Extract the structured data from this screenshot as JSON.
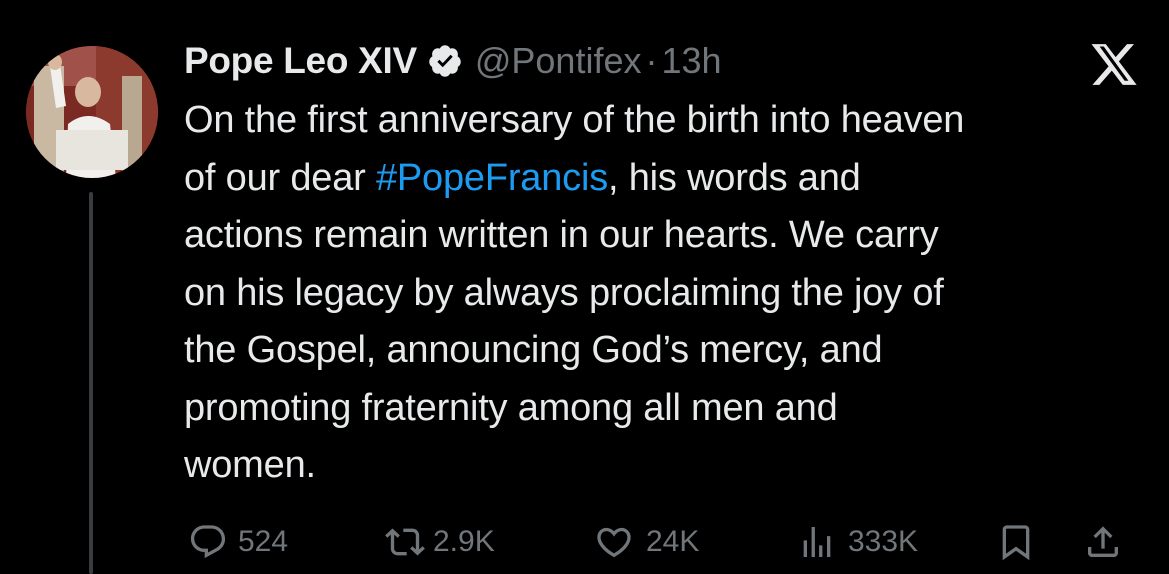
{
  "author": {
    "display_name": "Pope Leo XIV",
    "handle": "@Pontifex",
    "separator": "·",
    "time_ago": "13h",
    "verified": true
  },
  "platform_icon": "x-logo-icon",
  "tweet": {
    "lines": [
      [
        {
          "t": "On the first anniversary of the birth into heaven"
        }
      ],
      [
        {
          "t": "of our dear "
        },
        {
          "t": "#PopeFrancis",
          "tag": true
        },
        {
          "t": ", his words and"
        }
      ],
      [
        {
          "t": "actions remain written in our hearts. We carry"
        }
      ],
      [
        {
          "t": "on his legacy by always proclaiming the joy of"
        }
      ],
      [
        {
          "t": "the Gospel, announcing God’s mercy, and"
        }
      ],
      [
        {
          "t": "promoting fraternity among all men and"
        }
      ],
      [
        {
          "t": "women."
        }
      ]
    ],
    "hashtag": "#PopeFrancis"
  },
  "actions": {
    "replies": "524",
    "reposts": "2.9K",
    "likes": "24K",
    "views": "333K"
  },
  "colors": {
    "background": "#000000",
    "text": "#e7e9ea",
    "muted": "#71767b",
    "link": "#1d9bf0",
    "verified_badge": "#e7e9ea"
  }
}
